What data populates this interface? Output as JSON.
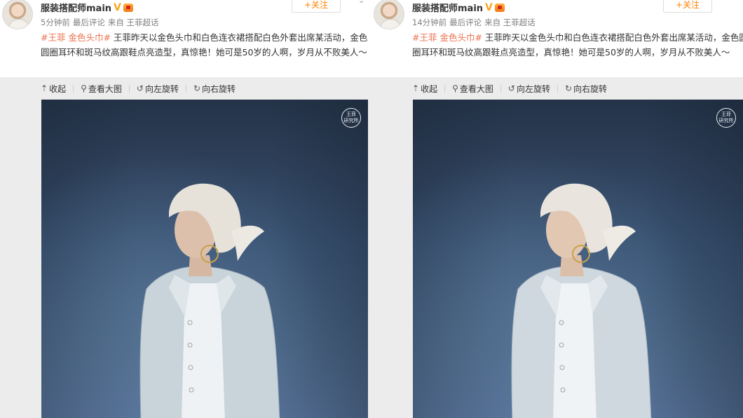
{
  "posts": [
    {
      "username": "服装搭配师main",
      "verified_icon": "V",
      "follow_label": "+关注",
      "time": "5分钟前",
      "last_comment": "最后评论",
      "source": "来自 王菲超话",
      "topic": "#王菲 金色头巾#",
      "text": " 王菲昨天以金色头巾和白色连衣裙搭配白色外套出席某活动，金色圆圈耳环和斑马纹高跟鞋点亮造型，真惊艳！她可是50岁的人啊，岁月从不败美人～",
      "toolbar": [
        "收起",
        "查看大图",
        "向左旋转",
        "向右旋转"
      ],
      "watermark": "王菲\n研究所"
    },
    {
      "username": "服装搭配师main",
      "verified_icon": "V",
      "follow_label": "+关注",
      "time": "14分钟前",
      "last_comment": "最后评论",
      "source": "来自 王菲超话",
      "topic": "#王菲 金色头巾#",
      "text": " 王菲昨天以金色头巾和白色连衣裙搭配白色外套出席某活动，金色圆圈耳环和斑马纹高跟鞋点亮造型，真惊艳！她可是50岁的人啊，岁月从不败美人～",
      "toolbar": [
        "收起",
        "查看大图",
        "向左旋转",
        "向右旋转"
      ],
      "watermark": "王菲\n研究所"
    }
  ],
  "colors": {
    "topic": "#eb7350",
    "follow": "#ff8200",
    "meta": "#808080",
    "verified": "#f6a623"
  },
  "icons": {
    "collapse": "collapse-arrow-icon",
    "view_large": "magnifier-icon",
    "rotate_left": "rotate-left-icon",
    "rotate_right": "rotate-right-icon",
    "dropdown": "chevron-down-icon"
  }
}
